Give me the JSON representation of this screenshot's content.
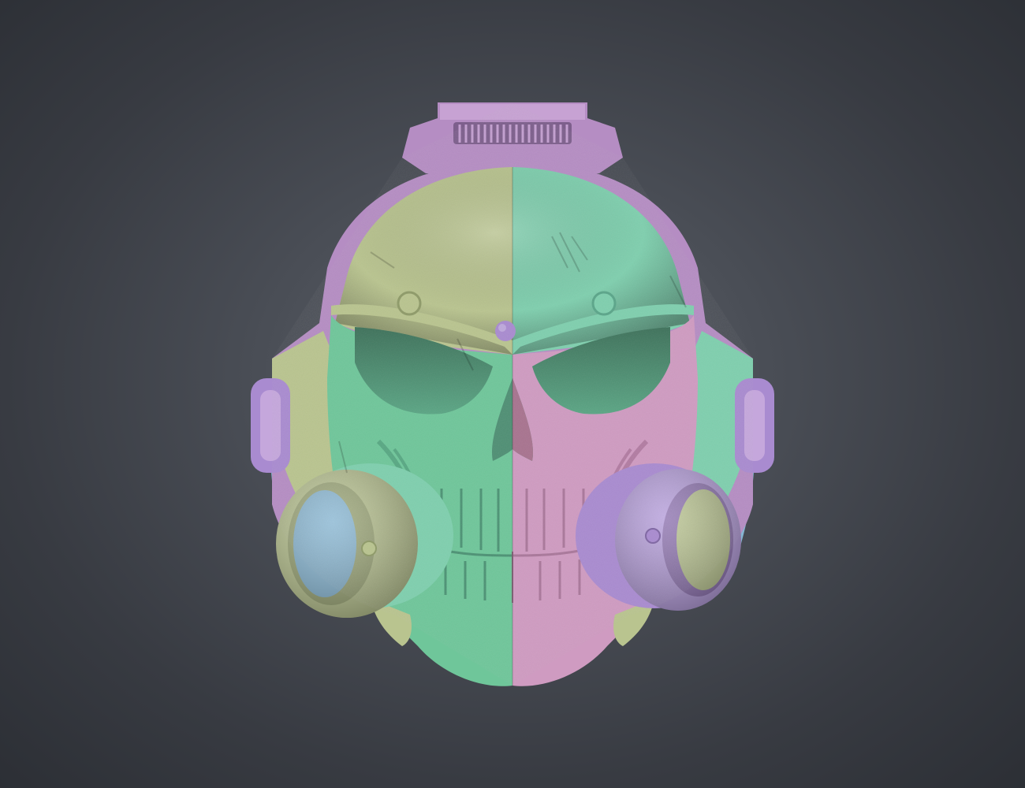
{
  "scene": {
    "subject": "sculpted-skull-helmet-with-respirator",
    "render_style": "polypaint-id-colors",
    "colors": {
      "background_center": "#5f636b",
      "background_edge": "#2c2f35",
      "purple": "#b58dc3",
      "violet": "#a98bd0",
      "sage": "#b9c48f",
      "mint": "#7fcfae",
      "green": "#6fc69a",
      "pink": "#cf9bc1",
      "blue": "#86b6d3"
    }
  }
}
